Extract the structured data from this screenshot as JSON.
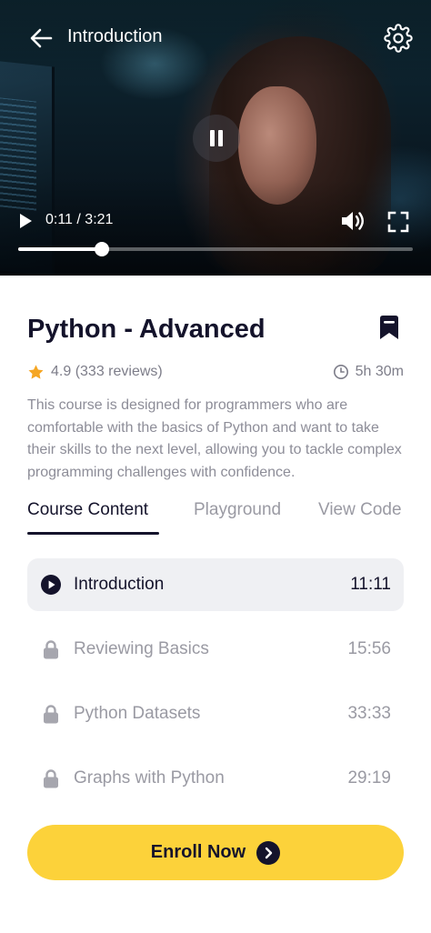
{
  "video": {
    "title": "Introduction",
    "time_display": "0:11 / 3:21",
    "progress_fraction": 0.213,
    "icons": {
      "back": "back-arrow-icon",
      "settings": "gear-icon",
      "pause": "pause-icon",
      "play": "play-icon",
      "volume": "volume-icon",
      "fullscreen": "fullscreen-icon"
    }
  },
  "course": {
    "title": "Python - Advanced",
    "rating": "4.9",
    "reviews": "(333 reviews)",
    "duration": "5h 30m",
    "description": "This course is designed for programmers who are comfortable with the basics of Python and want to take their skills to the next level, allowing you to tackle complex programming challenges with confidence.",
    "icons": {
      "bookmark": "bookmark-icon",
      "star": "star-icon",
      "clock": "clock-icon"
    }
  },
  "tabs": [
    {
      "label": "Course Content",
      "active": true
    },
    {
      "label": "Playground",
      "active": false
    },
    {
      "label": "View Code",
      "active": false
    }
  ],
  "lessons": [
    {
      "name": "Introduction",
      "time": "11:11",
      "state": "playing",
      "icon": "play-circle-icon"
    },
    {
      "name": "Reviewing Basics",
      "time": "15:56",
      "state": "locked",
      "icon": "lock-icon"
    },
    {
      "name": "Python Datasets",
      "time": "33:33",
      "state": "locked",
      "icon": "lock-icon"
    },
    {
      "name": "Graphs with Python",
      "time": "29:19",
      "state": "locked",
      "icon": "lock-icon"
    }
  ],
  "enroll": {
    "label": "Enroll Now",
    "icon": "chevron-right-circle-icon"
  },
  "colors": {
    "accent": "#fcd23a",
    "primary_text": "#14132b",
    "muted_text": "#9a9aa3",
    "star": "#f5a623",
    "active_row_bg": "#eff0f3"
  }
}
